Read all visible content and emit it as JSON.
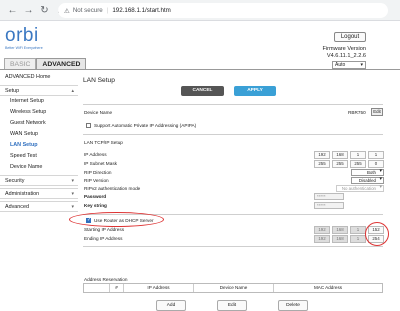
{
  "browser": {
    "security_label": "Not secure",
    "url": "192.168.1.1/start.htm"
  },
  "logo": {
    "word": "orbi",
    "tagline": "Better WiFi Everywhere"
  },
  "tabs": [
    "BASIC",
    "ADVANCED"
  ],
  "header": {
    "logout_label": "Logout",
    "firmware_label": "Firmware Version",
    "firmware_value": "V4.6.11.1_2.2.6",
    "language": "Auto"
  },
  "sidebar": {
    "home": "ADVANCED Home",
    "setup": "Setup",
    "setup_items": [
      "Internet Setup",
      "Wireless Setup",
      "Guest Network",
      "WAN Setup",
      "LAN Setup",
      "Speed Test",
      "Device Name"
    ],
    "security": "Security",
    "administration": "Administration",
    "advanced": "Advanced"
  },
  "main": {
    "title": "LAN Setup",
    "cancel_label": "CANCEL",
    "apply_label": "APPLY",
    "device_name_label": "Device Name",
    "device_name_value": "RBR750",
    "edit_label": "Edit",
    "apipa_label": "Support Automatic Private IP Addressing (APIPA)",
    "tcpip_title": "LAN TCP/IP Setup",
    "ip_label": "IP Address",
    "ip": [
      "192",
      "168",
      "1",
      "1"
    ],
    "mask_label": "IP Subnet Mask",
    "mask": [
      "255",
      "255",
      "255",
      "0"
    ],
    "rip_dir_label": "RIP Direction",
    "rip_dir_value": "Both",
    "rip_ver_label": "RIP Version",
    "rip_ver_value": "Disabled",
    "rip2_auth_label": "RIPv2 authentication mode",
    "rip2_auth_value": "No authentication",
    "password_label": "Password",
    "password_value": "*****",
    "keystring_label": "Key string",
    "keystring_value": "*****",
    "dhcp_label": "Use Router as DHCP Server",
    "start_ip_label": "Starting IP Address",
    "start_ip": [
      "192",
      "168",
      "1",
      "152"
    ],
    "end_ip_label": "Ending IP Address",
    "end_ip": [
      "192",
      "168",
      "1",
      "254"
    ],
    "reservation_title": "Address Reservation",
    "table_headers": [
      "",
      "#",
      "IP Address",
      "Device Name",
      "MAC Address"
    ],
    "add_label": "Add",
    "edit_btn_label": "Edit",
    "delete_label": "Delete"
  },
  "colors": {
    "accent": "#3aa0d6",
    "logo": "#3b78c2",
    "annotation": "#d33333"
  }
}
